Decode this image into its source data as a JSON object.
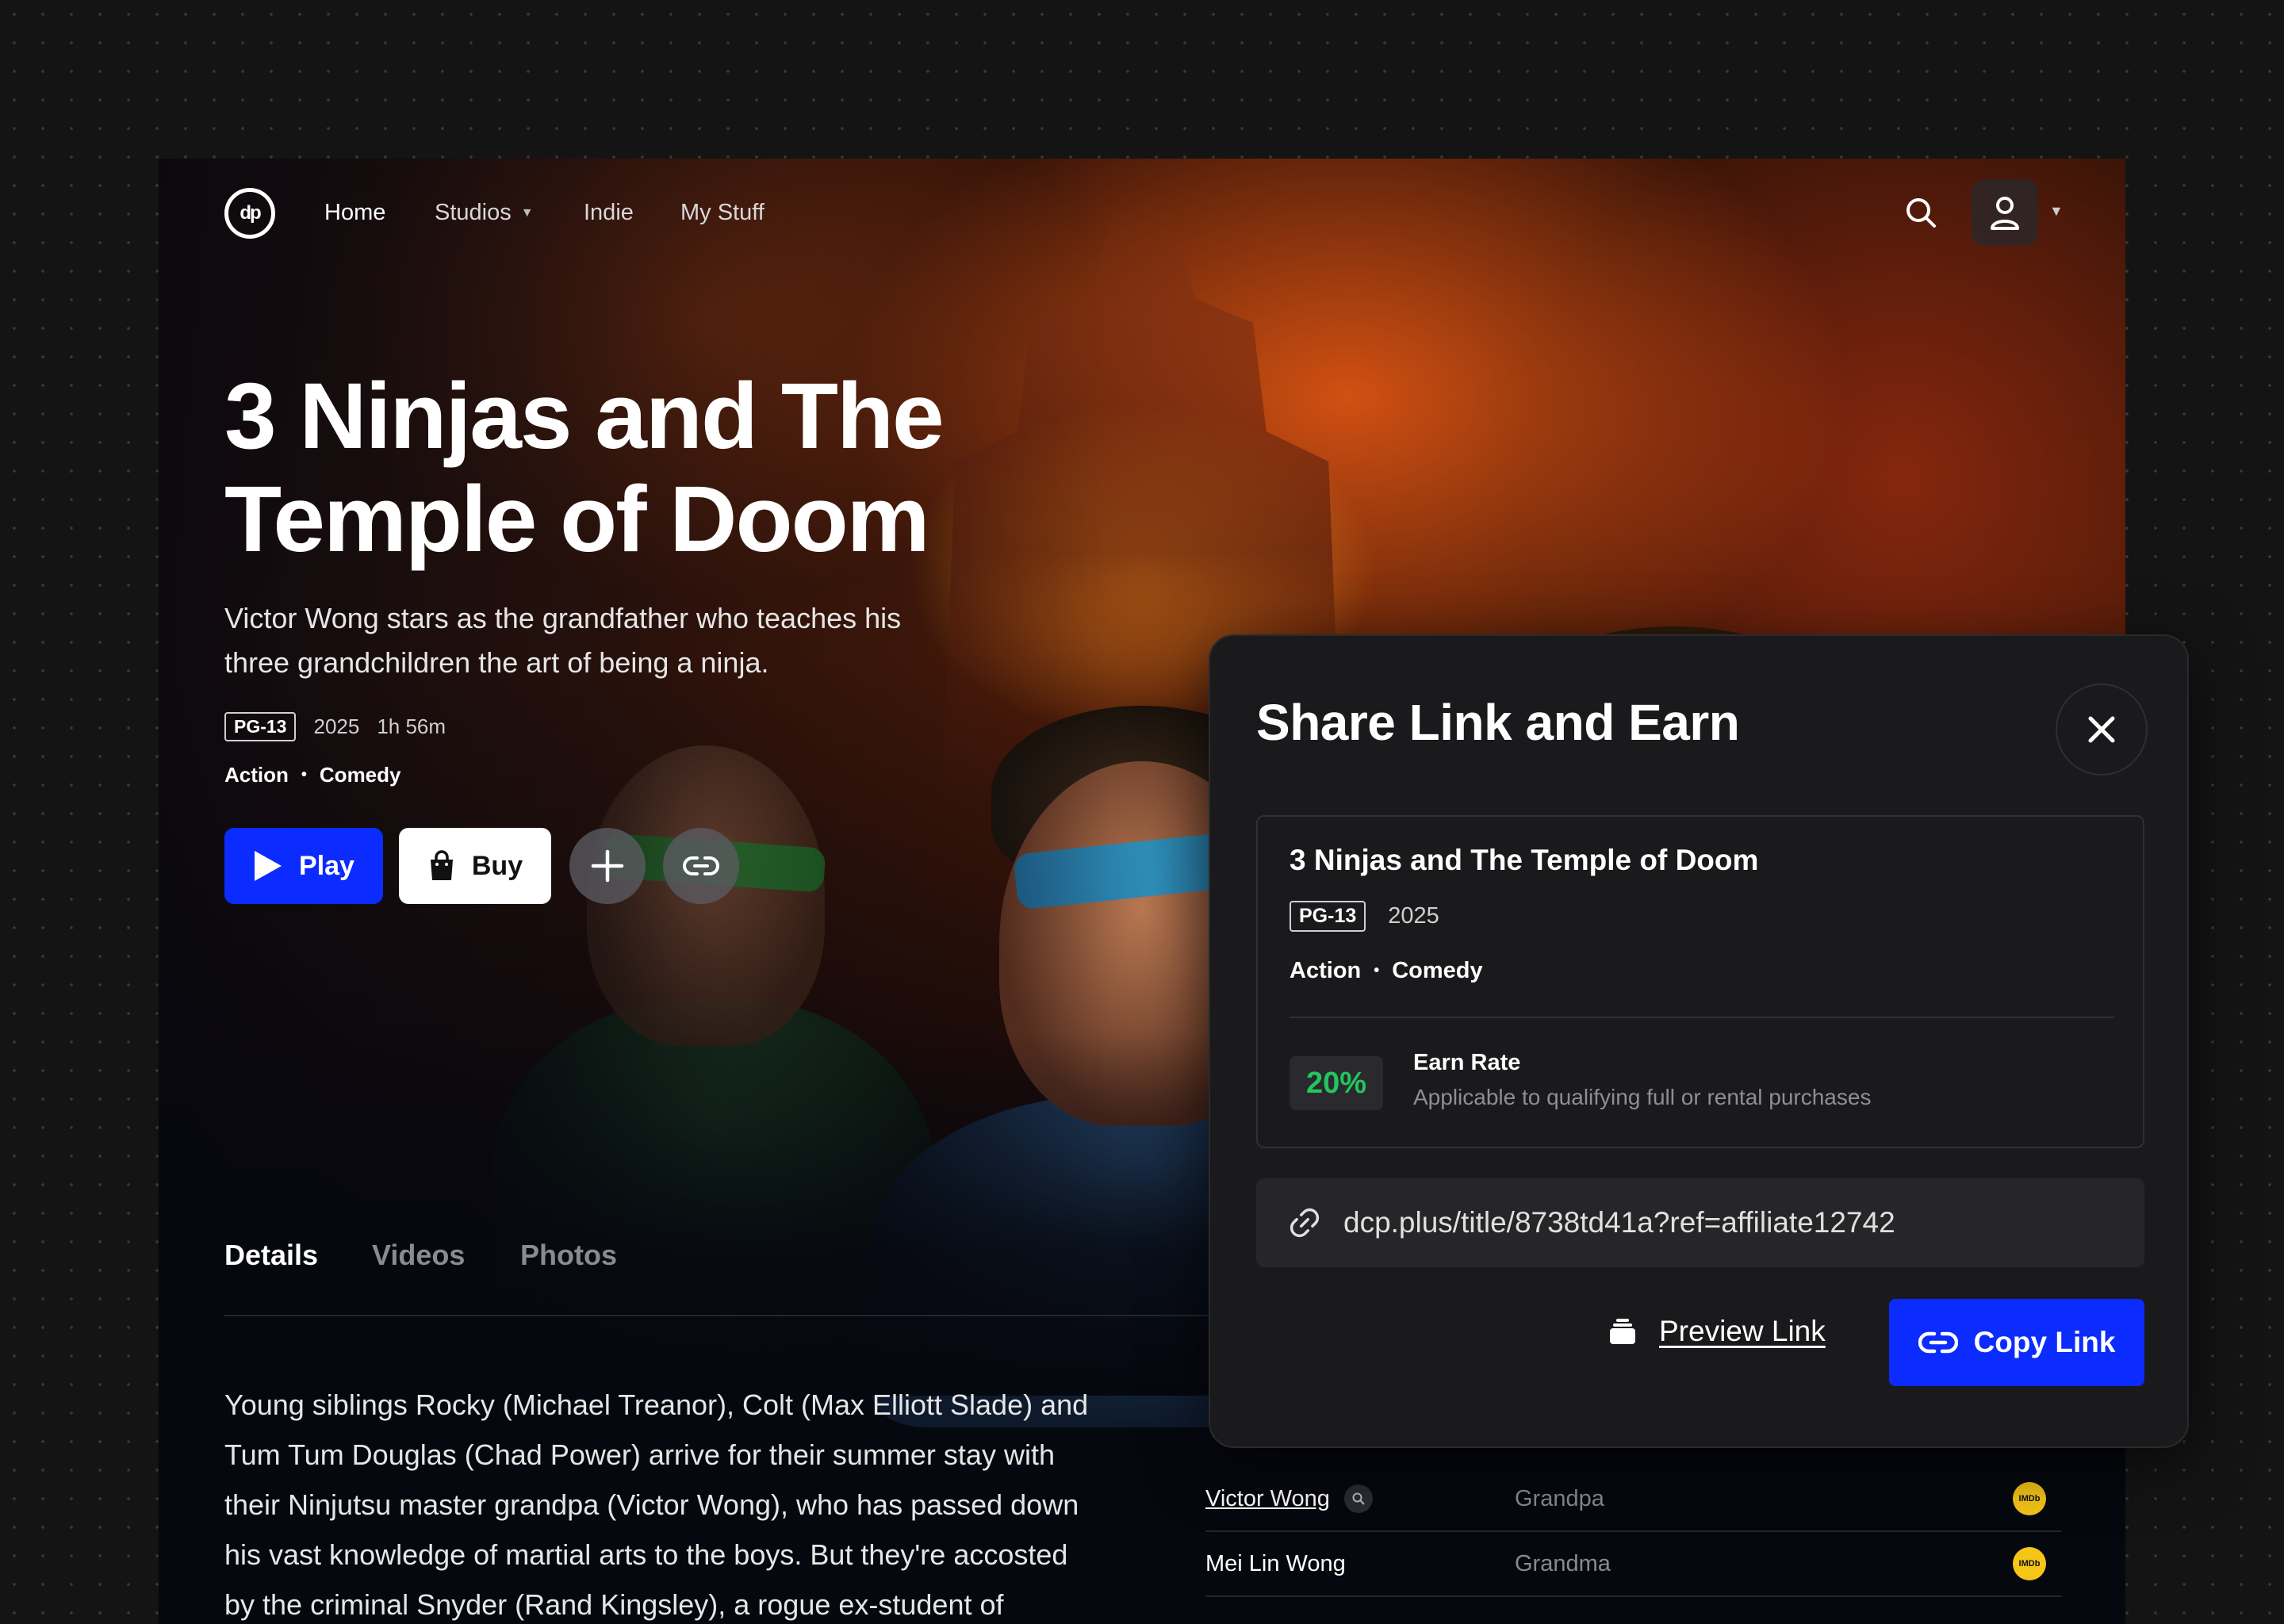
{
  "nav": {
    "logo_text": "dp",
    "items": [
      {
        "label": "Home"
      },
      {
        "label": "Studios"
      },
      {
        "label": "Indie"
      },
      {
        "label": "My Stuff"
      }
    ]
  },
  "hero": {
    "title_line1": "3 Ninjas and The",
    "title_line2": "Temple of Doom",
    "synopsis": "Victor Wong stars as the grandfather who teaches his three grandchildren the art of being a ninja.",
    "rating": "PG-13",
    "year": "2025",
    "runtime": "1h 56m",
    "genres": [
      "Action",
      "Comedy"
    ],
    "play_label": "Play",
    "buy_label": "Buy"
  },
  "tabs": [
    {
      "label": "Details"
    },
    {
      "label": "Videos"
    },
    {
      "label": "Photos"
    }
  ],
  "description": "Young siblings Rocky (Michael Treanor), Colt (Max Elliott Slade) and Tum Tum Douglas (Chad Power) arrive for their summer stay with their Ninjutsu master grandpa (Victor Wong), who has passed down his vast knowledge of martial arts to the boys. But they're accosted by the criminal Snyder (Rand Kingsley), a rogue ex-student of",
  "cast": [
    {
      "name": "Victor Wong",
      "role": "Grandpa",
      "badge": "IMDb"
    },
    {
      "name": "Mei Lin Wong",
      "role": "Grandma",
      "badge": "IMDb"
    }
  ],
  "modal": {
    "title": "Share Link and Earn",
    "movie_title": "3 Ninjas and The Temple of Doom",
    "rating": "PG-13",
    "year": "2025",
    "genres": [
      "Action",
      "Comedy"
    ],
    "earn_rate_value": "20%",
    "earn_rate_label": "Earn Rate",
    "earn_rate_sub": "Applicable to qualifying full or rental purchases",
    "share_url": "dcp.plus/title/8738td41a?ref=affiliate12742",
    "preview_label": "Preview Link",
    "copy_label": "Copy Link"
  },
  "colors": {
    "accent_blue": "#0b2bff",
    "earn_green": "#22c55e",
    "imdb_yellow": "#f5c518",
    "modal_bg": "#1a1a1c"
  }
}
